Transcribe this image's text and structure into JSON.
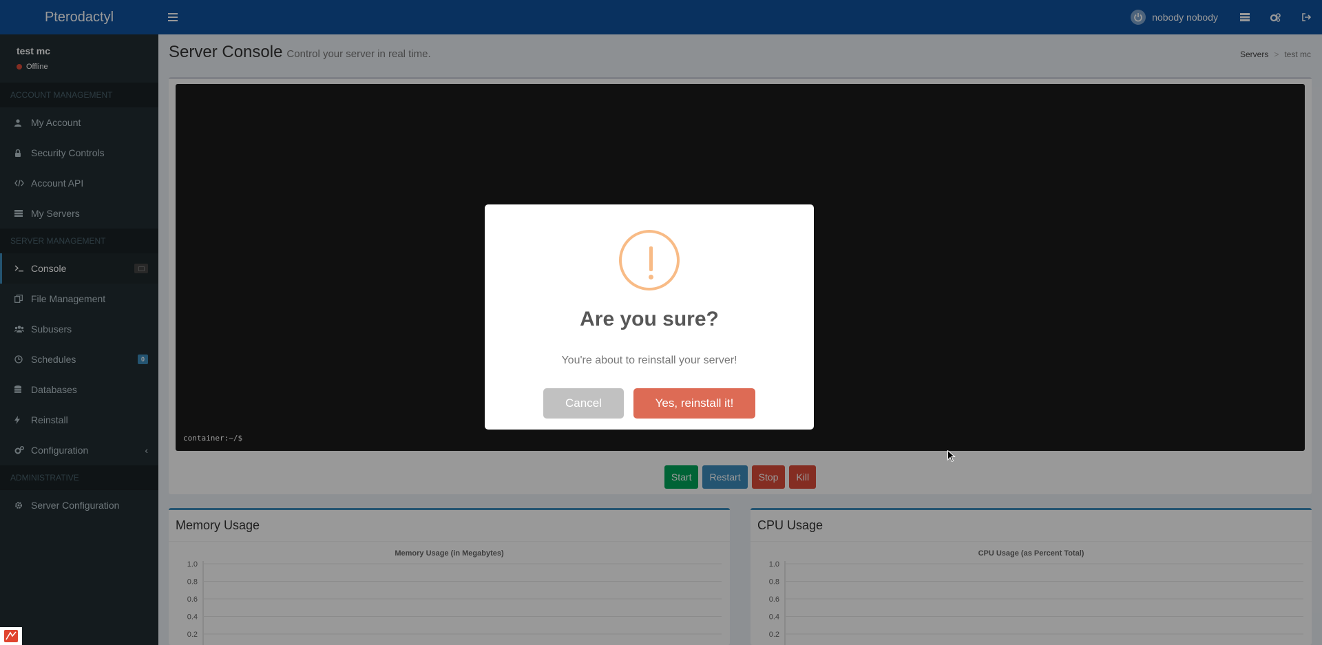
{
  "header": {
    "app_name": "Pterodactyl",
    "menu_toggle_icon": "hamburger-icon",
    "user_name": "nobody nobody"
  },
  "sidebar": {
    "server_name": "test mc",
    "server_status": "Offline",
    "status_color": "#dd4b39",
    "sections": {
      "account": "ACCOUNT MANAGEMENT",
      "server": "SERVER MANAGEMENT",
      "admin": "ADMINISTRATIVE"
    },
    "account_items": [
      {
        "label": "My Account",
        "icon": "user-icon"
      },
      {
        "label": "Security Controls",
        "icon": "lock-icon"
      },
      {
        "label": "Account API",
        "icon": "code-icon"
      },
      {
        "label": "My Servers",
        "icon": "server-icon"
      }
    ],
    "server_items": [
      {
        "label": "Console",
        "icon": "terminal-icon"
      },
      {
        "label": "File Management",
        "icon": "files-icon"
      },
      {
        "label": "Subusers",
        "icon": "users-icon"
      },
      {
        "label": "Schedules",
        "icon": "clock-icon",
        "badge": "0"
      },
      {
        "label": "Databases",
        "icon": "database-icon"
      },
      {
        "label": "Reinstall",
        "icon": "bolt-icon"
      },
      {
        "label": "Configuration",
        "icon": "gears-icon"
      }
    ],
    "admin_items": [
      {
        "label": "Server Configuration",
        "icon": "gear-icon"
      }
    ]
  },
  "page": {
    "title": "Server Console",
    "subtitle": "Control your server in real time.",
    "breadcrumb": [
      "Servers",
      "test mc"
    ]
  },
  "console": {
    "prompt": "container:~/$",
    "buttons": {
      "start": "Start",
      "restart": "Restart",
      "stop": "Stop",
      "kill": "Kill"
    }
  },
  "charts": {
    "memory_box_title": "Memory Usage",
    "cpu_box_title": "CPU Usage"
  },
  "chart_data": [
    {
      "type": "line",
      "title": "Memory Usage (in Megabytes)",
      "yticks": [
        "1.0",
        "0.8",
        "0.6",
        "0.4",
        "0.2"
      ],
      "series": [],
      "ylim": [
        0,
        1
      ]
    },
    {
      "type": "line",
      "title": "CPU Usage (as Percent Total)",
      "yticks": [
        "1.0",
        "0.8",
        "0.6",
        "0.4",
        "0.2"
      ],
      "series": [],
      "ylim": [
        0,
        1
      ]
    }
  ],
  "modal": {
    "icon": "warning-icon",
    "title": "Are you sure?",
    "text": "You're about to reinstall your server!",
    "cancel_label": "Cancel",
    "confirm_label": "Yes, reinstall it!",
    "confirm_color": "#dd6b55",
    "cancel_color": "#c1c1c1"
  }
}
